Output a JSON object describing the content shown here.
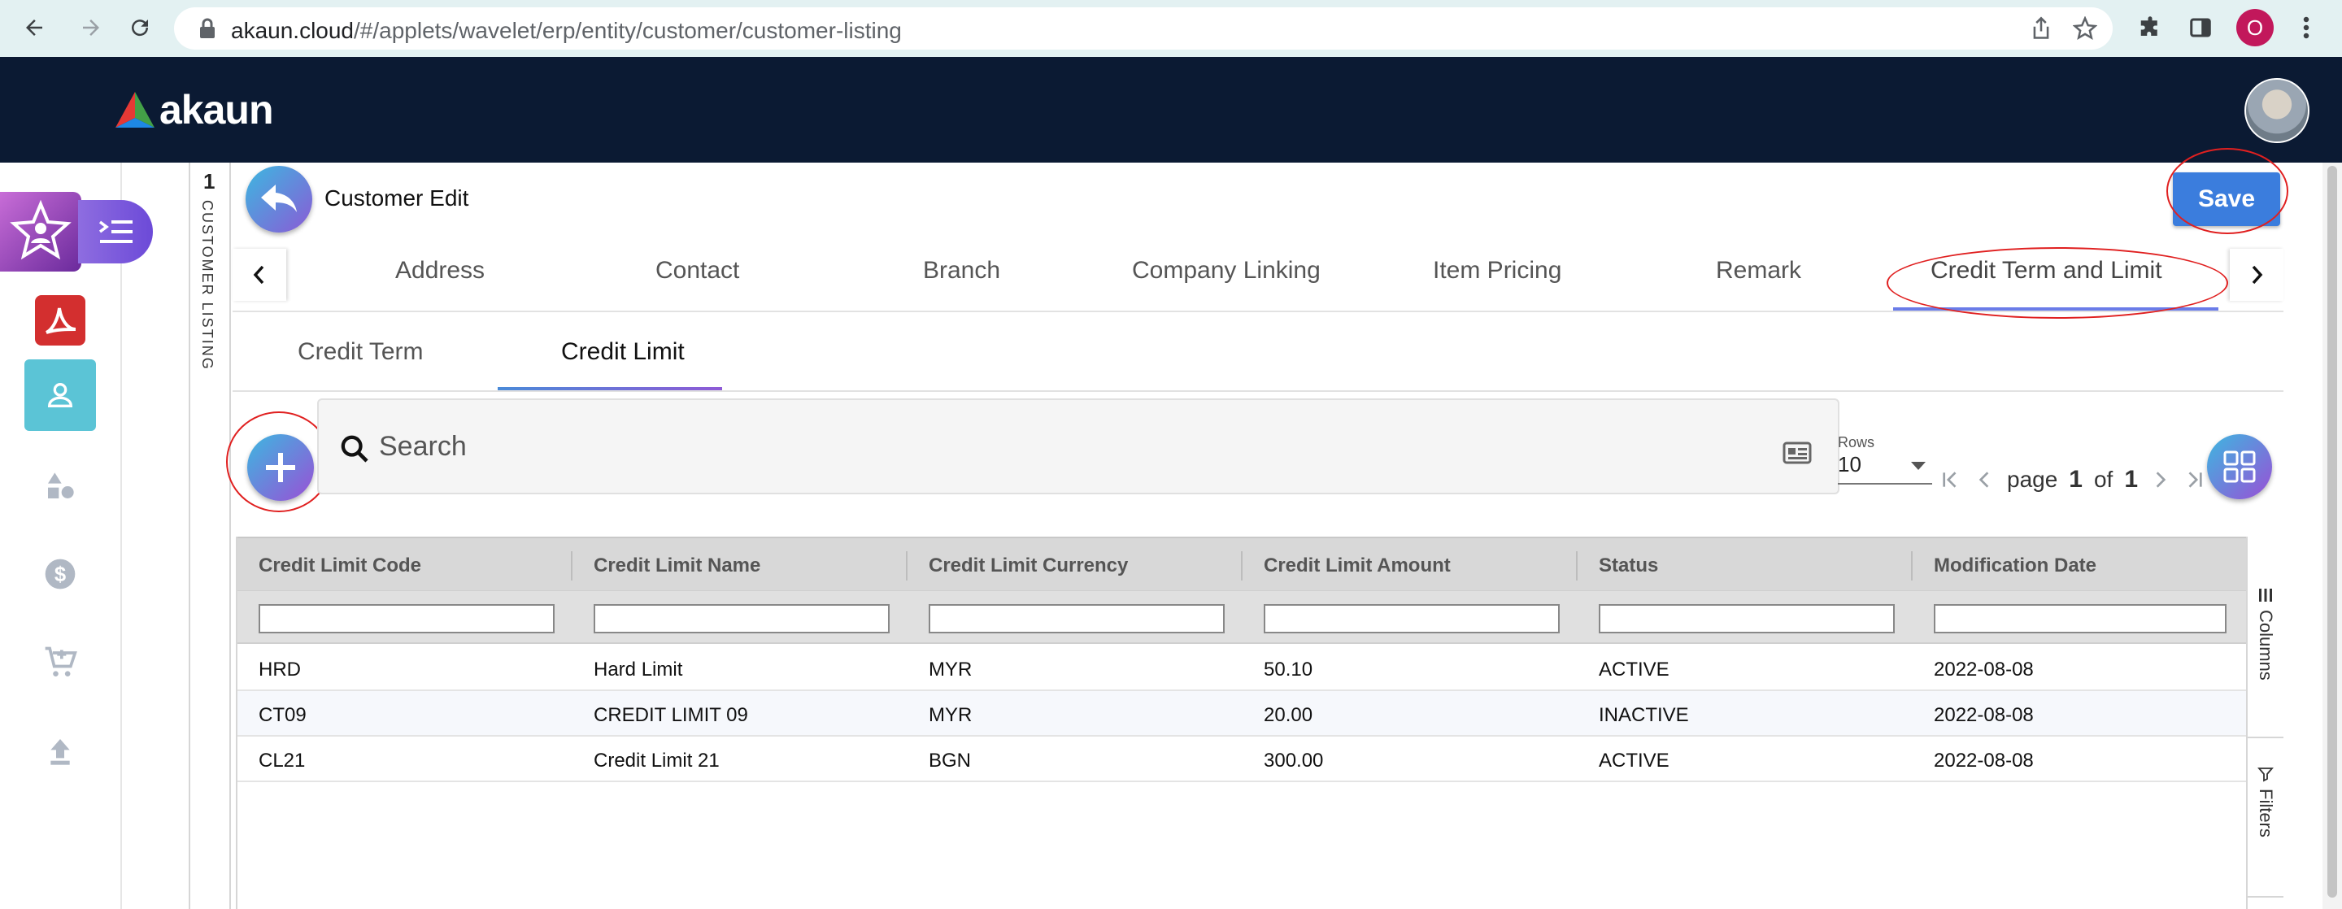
{
  "browser": {
    "url_host": "akaun.cloud",
    "url_path": "/#/applets/wavelet/erp/entity/customer/customer-listing",
    "profile_initial": "O"
  },
  "app": {
    "brand": "akaun",
    "brand_colors": [
      "#e53935",
      "#43a047",
      "#1e88e5"
    ],
    "header_bg": "#0b1a33"
  },
  "rail": {
    "icons": [
      "star-user-icon",
      "menu-toggle-icon",
      "pdf-app-icon",
      "person-icon",
      "shapes-icon",
      "dollar-icon",
      "cart-icon",
      "upload-icon"
    ],
    "active": "person-icon"
  },
  "breadcrumb_strip": {
    "count": "1",
    "label": "CUSTOMER LISTING"
  },
  "page": {
    "title": "Customer Edit",
    "save_label": "Save"
  },
  "tabs": [
    {
      "label": "Address"
    },
    {
      "label": "Contact"
    },
    {
      "label": "Branch"
    },
    {
      "label": "Company Linking"
    },
    {
      "label": "Item Pricing"
    },
    {
      "label": "Remark"
    },
    {
      "label": "Credit Term and Limit",
      "active": true
    }
  ],
  "subtabs": [
    {
      "label": "Credit Term"
    },
    {
      "label": "Credit Limit",
      "active": true
    }
  ],
  "search": {
    "placeholder": "Search"
  },
  "pagination": {
    "rows_label": "Rows",
    "rows_value": "10",
    "page_word": "page",
    "current_page": "1",
    "of_word": "of",
    "total_pages": "1"
  },
  "table": {
    "columns": [
      "Credit Limit Code",
      "Credit Limit Name",
      "Credit Limit Currency",
      "Credit Limit Amount",
      "Status",
      "Modification Date"
    ],
    "rows": [
      [
        "HRD",
        "Hard Limit",
        "MYR",
        "50.10",
        "ACTIVE",
        "2022-08-08"
      ],
      [
        "CT09",
        "CREDIT LIMIT 09",
        "MYR",
        "20.00",
        "INACTIVE",
        "2022-08-08"
      ],
      [
        "CL21",
        "Credit Limit 21",
        "BGN",
        "300.00",
        "ACTIVE",
        "2022-08-08"
      ]
    ]
  },
  "side_panel": {
    "columns_label": "Columns",
    "filters_label": "Filters"
  },
  "annotation_color": "#e02020"
}
